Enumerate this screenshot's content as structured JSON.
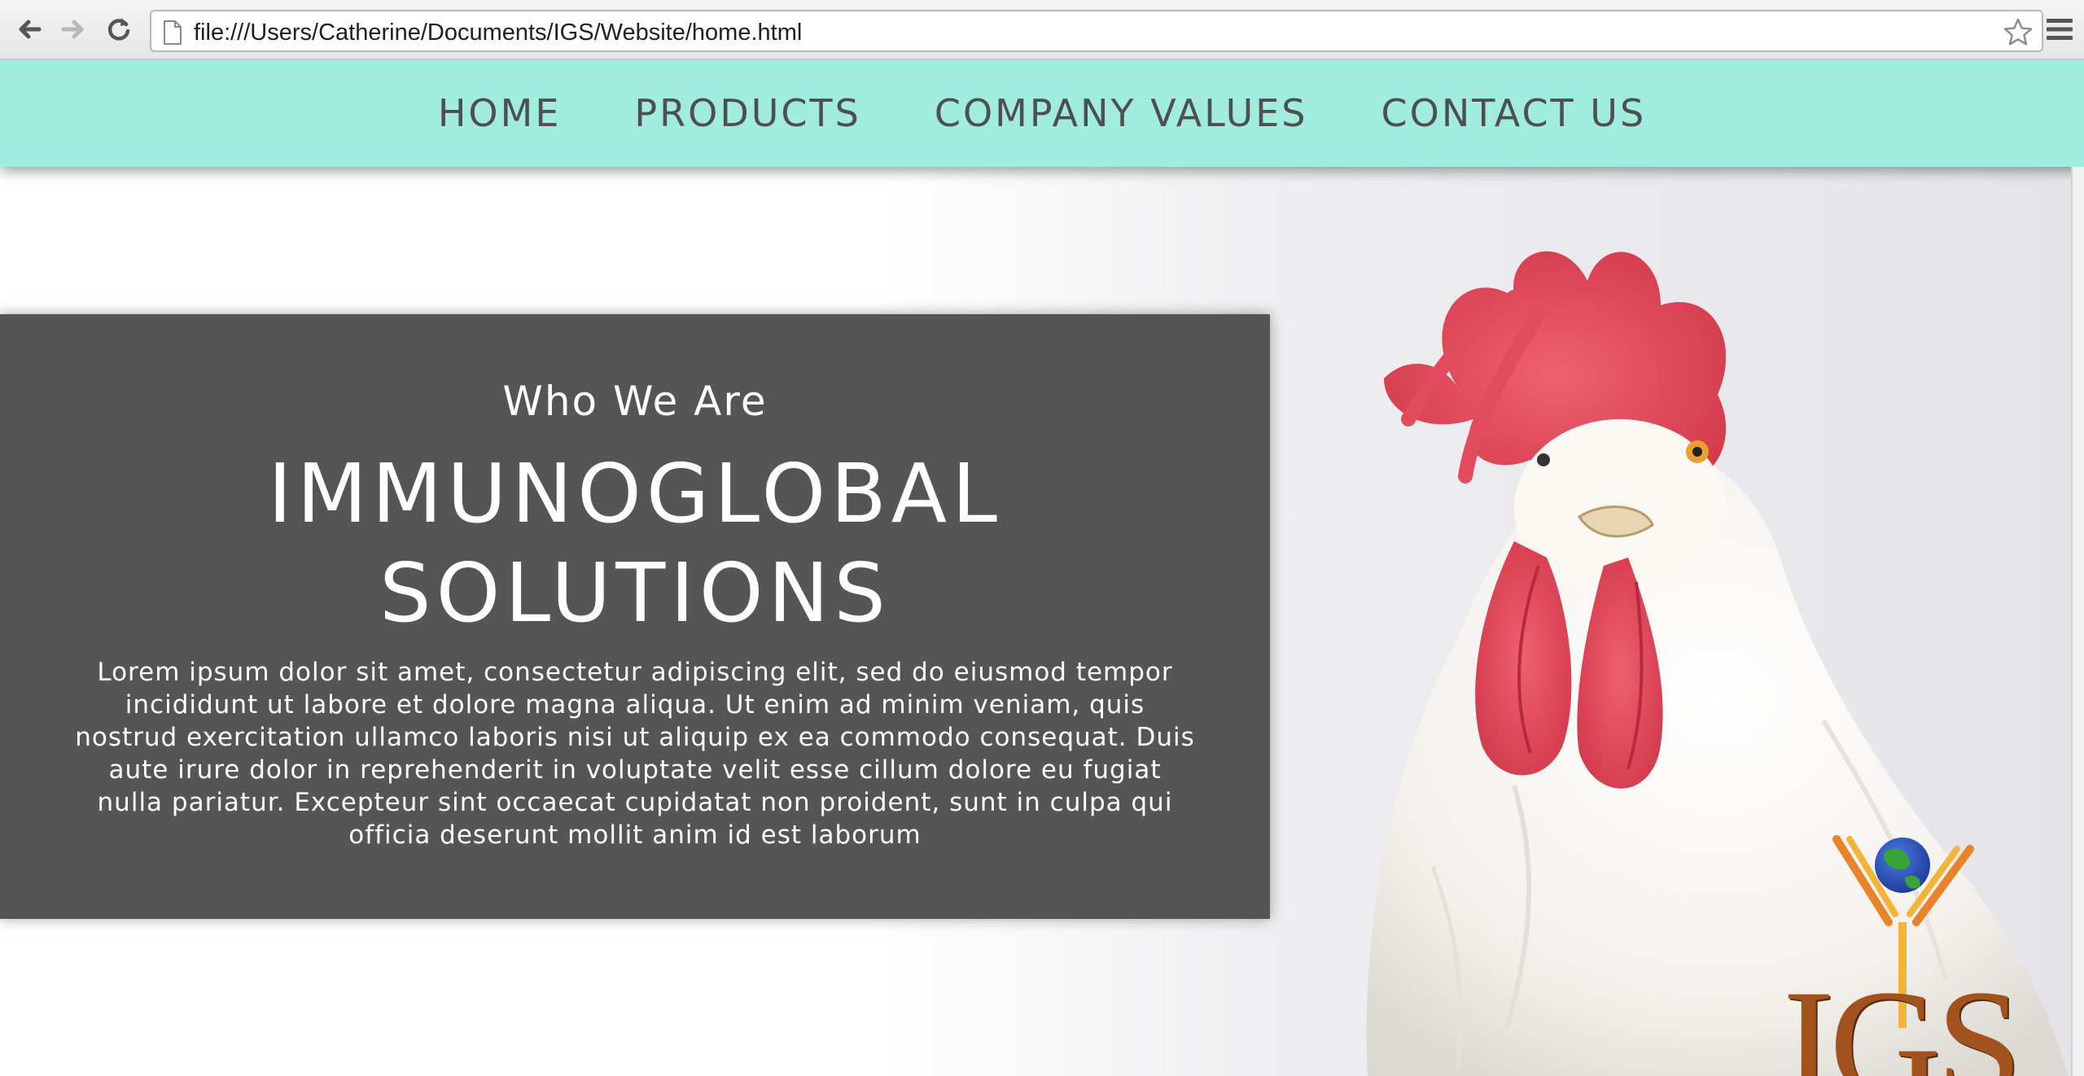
{
  "browser": {
    "url": "file:///Users/Catherine/Documents/IGS/Website/home.html"
  },
  "site_nav": {
    "items": [
      {
        "label": "HOME"
      },
      {
        "label": "PRODUCTS"
      },
      {
        "label": "COMPANY VALUES"
      },
      {
        "label": "CONTACT US"
      }
    ]
  },
  "hero": {
    "subtitle": "Who We Are",
    "title_line1": "IMMUNOGLOBAL",
    "title_line2": "SOLUTIONS",
    "body": "Lorem ipsum dolor sit amet, consectetur adipiscing elit, sed do eiusmod tempor incididunt ut labore et dolore magna aliqua. Ut enim ad minim veniam, quis nostrud exercitation ullamco laboris nisi ut aliquip ex ea commodo consequat. Duis aute irure dolor in reprehenderit in voluptate velit esse cillum dolore eu fugiat nulla pariatur. Excepteur sint occaecat cupidatat non proident, sunt in culpa qui officia deserunt mollit anim id est laborum"
  },
  "logo": {
    "text": "IGS"
  },
  "colors": {
    "nav_background": "#a0ede0",
    "panel_background": "#555555",
    "logo_brown": "#a2521c"
  },
  "icons": {
    "back": "back-arrow-icon",
    "forward": "forward-arrow-icon",
    "reload": "reload-icon",
    "page": "page-icon",
    "bookmark": "star-icon",
    "menu": "hamburger-menu-icon"
  }
}
